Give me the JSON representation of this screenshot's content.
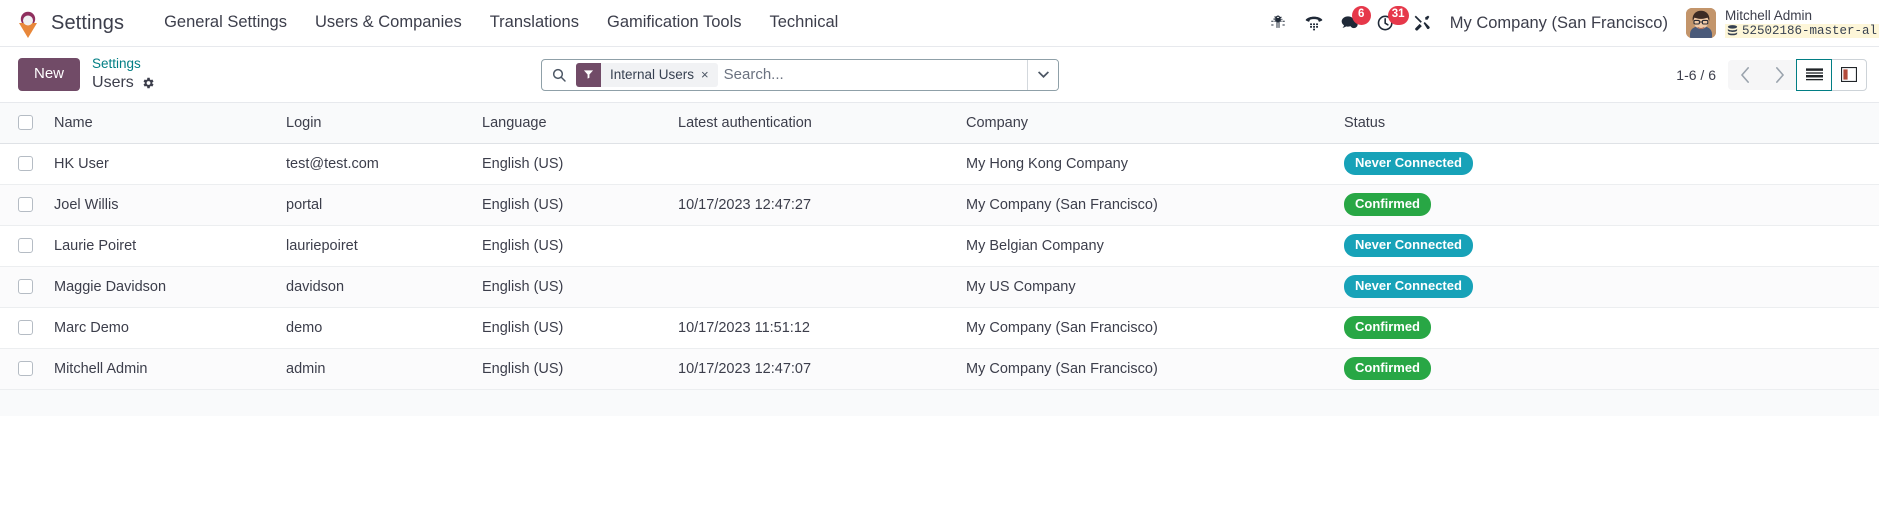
{
  "navbar": {
    "app_name": "Settings",
    "logo_icon": "odoo-logo-icon",
    "menu_items": [
      {
        "label": "General Settings",
        "name": "menu-general-settings"
      },
      {
        "label": "Users & Companies",
        "name": "menu-users-companies"
      },
      {
        "label": "Translations",
        "name": "menu-translations"
      },
      {
        "label": "Gamification Tools",
        "name": "menu-gamification-tools"
      },
      {
        "label": "Technical",
        "name": "menu-technical"
      }
    ],
    "system_icons": [
      {
        "name": "bug-icon",
        "badge": ""
      },
      {
        "name": "phone-dialpad-icon",
        "badge": ""
      },
      {
        "name": "messaging-chat-icon",
        "badge": "6"
      },
      {
        "name": "activities-clock-icon",
        "badge": "31"
      },
      {
        "name": "tools-wrench-icon",
        "badge": ""
      }
    ],
    "messaging_count": "6",
    "activities_count": "31",
    "company_selector": "My Company (San Francisco)",
    "user": {
      "name": "Mitchell Admin",
      "database": "52502186-master-al",
      "db_icon": "database-icon",
      "avatar_name": "avatar"
    }
  },
  "control_panel": {
    "new_label": "New",
    "breadcrumb_parent": "Settings",
    "breadcrumb_current": "Users",
    "gear_icon": "gear-icon",
    "search": {
      "search_icon": "search-icon",
      "facet_icon": "filter-funnel-icon",
      "facet_label": "Internal Users",
      "facet_remove": "×",
      "placeholder": "Search...",
      "value": "",
      "dropdown_icon": "chevron-down-icon"
    },
    "pager": {
      "range": "1-6 / 6",
      "prev_icon": "chevron-left-icon",
      "next_icon": "chevron-right-icon"
    },
    "views": [
      {
        "name": "view-switcher-list",
        "icon": "list-view-icon",
        "active": true
      },
      {
        "name": "view-switcher-kanban",
        "icon": "kanban-view-icon",
        "active": false
      }
    ]
  },
  "table": {
    "headers": [
      "Name",
      "Login",
      "Language",
      "Latest authentication",
      "Company",
      "Status"
    ],
    "select_all_name": "select-all-checkbox",
    "rows": [
      {
        "name": "HK User",
        "login": "test@test.com",
        "language": "English (US)",
        "latest_authentication": "",
        "company": "My Hong Kong Company",
        "status": "Never Connected",
        "status_kind": "info"
      },
      {
        "name": "Joel Willis",
        "login": "portal",
        "language": "English (US)",
        "latest_authentication": "10/17/2023 12:47:27",
        "company": "My Company (San Francisco)",
        "status": "Confirmed",
        "status_kind": "success"
      },
      {
        "name": "Laurie Poiret",
        "login": "lauriepoiret",
        "language": "English (US)",
        "latest_authentication": "",
        "company": "My Belgian Company",
        "status": "Never Connected",
        "status_kind": "info"
      },
      {
        "name": "Maggie Davidson",
        "login": "davidson",
        "language": "English (US)",
        "latest_authentication": "",
        "company": "My US Company",
        "status": "Never Connected",
        "status_kind": "info"
      },
      {
        "name": "Marc Demo",
        "login": "demo",
        "language": "English (US)",
        "latest_authentication": "10/17/2023 11:51:12",
        "company": "My Company (San Francisco)",
        "status": "Confirmed",
        "status_kind": "success"
      },
      {
        "name": "Mitchell Admin",
        "login": "admin",
        "language": "English (US)",
        "latest_authentication": "10/17/2023 12:47:07",
        "company": "My Company (San Francisco)",
        "status": "Confirmed",
        "status_kind": "success"
      }
    ]
  },
  "colors": {
    "brand_purple": "#714b67",
    "accent_teal": "#017e84",
    "badge_red": "#e6384a",
    "status_info": "#17a2b8",
    "status_success": "#28a745"
  }
}
